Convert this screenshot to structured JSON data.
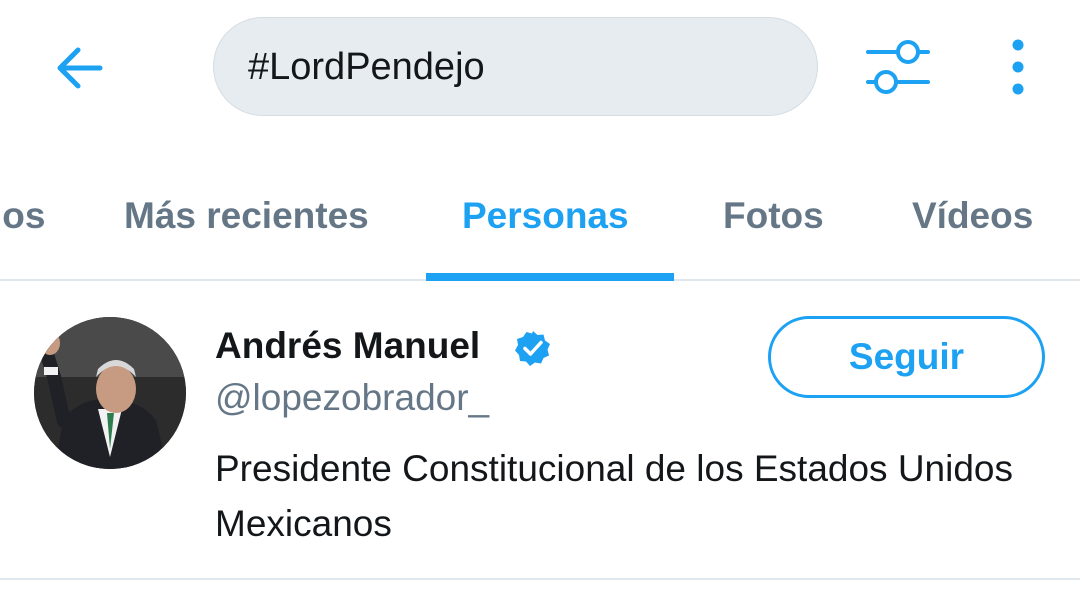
{
  "colors": {
    "accent": "#1da1f2",
    "text_primary": "#14171a",
    "text_secondary": "#657786",
    "search_bg": "#e6ecf0"
  },
  "header": {
    "back_icon": "arrow-left-icon",
    "search_value": "#LordPendejo",
    "filter_icon": "sliders-icon",
    "more_icon": "vertical-dots-icon"
  },
  "tabs": [
    {
      "label": "los",
      "active": false
    },
    {
      "label": "Más recientes",
      "active": false
    },
    {
      "label": "Personas",
      "active": true
    },
    {
      "label": "Fotos",
      "active": false
    },
    {
      "label": "Vídeos",
      "active": false
    }
  ],
  "results": [
    {
      "name": "Andrés Manuel",
      "verified": true,
      "handle": "@lopezobrador_",
      "bio": "Presidente Constitucional de los Estados Unidos Mexicanos",
      "follow_label": "Seguir"
    }
  ]
}
